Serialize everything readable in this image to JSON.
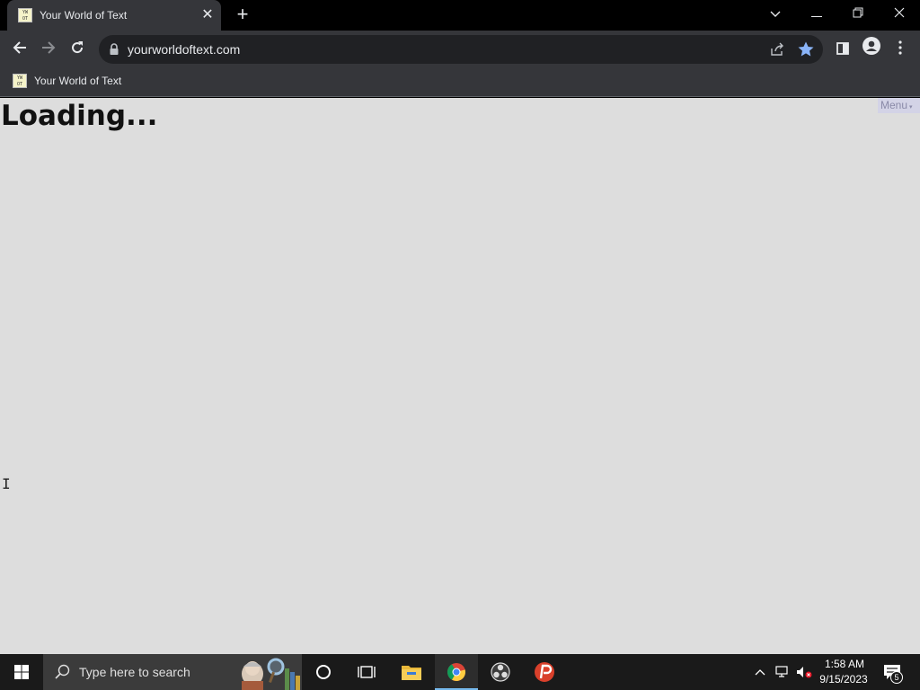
{
  "browser": {
    "tab": {
      "title": "Your World of Text",
      "favicon_text": "YW OT"
    },
    "url": "yourworldoftext.com",
    "bookmark": {
      "label": "Your World of Text"
    }
  },
  "page": {
    "loading_text": "Loading...",
    "menu_label": "Menu",
    "background": "#dddddd"
  },
  "taskbar": {
    "search_placeholder": "Type here to search",
    "time": "1:58 AM",
    "date": "9/15/2023",
    "notification_count": "5"
  },
  "icons": {
    "tab_close": "close-icon",
    "new_tab": "plus-icon",
    "back": "arrow-left-icon",
    "forward": "arrow-right-icon",
    "reload": "reload-icon",
    "lock": "lock-icon",
    "share": "share-icon",
    "bookmark_star": "star-icon",
    "side_panel": "side-panel-icon",
    "profile": "profile-icon",
    "more": "kebab-menu-icon"
  },
  "colors": {
    "chrome_dark": "#35363a",
    "accent_blue": "#8ab4f8"
  }
}
